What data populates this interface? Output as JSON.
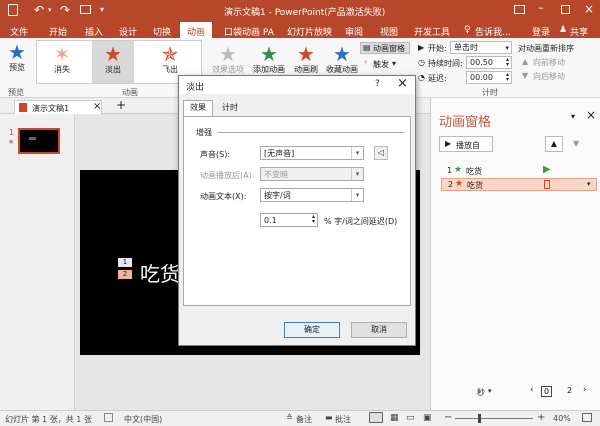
{
  "titlebar": {
    "title": "演示文稿1 - PowerPoint(产品激活失败)",
    "signin": "登录",
    "share": "共享"
  },
  "menu": {
    "items": [
      "文件",
      "开始",
      "插入",
      "设计",
      "切换",
      "动画",
      "口袋动画 PA",
      "幻灯片放映",
      "审阅",
      "视图",
      "开发工具"
    ],
    "tellme": "告诉我..."
  },
  "ribbon": {
    "preview": "预览",
    "effects": [
      {
        "label": "消失"
      },
      {
        "label": "淡出"
      },
      {
        "label": "飞出"
      }
    ],
    "effect_options": "效果选项",
    "add_animation": "添加动画",
    "painter": "动画刷",
    "anim_pane_btn": "动画窗格",
    "trigger": "触发",
    "painter2": "收藏动画",
    "start_label": "开始:",
    "start_value": "单击时",
    "duration_label": "持续时间:",
    "duration_value": "00.50",
    "delay_label": "延迟:",
    "delay_value": "00.00",
    "reorder_title": "对动画重新排序",
    "move_earlier": "向前移动",
    "move_later": "向后移动",
    "groups": {
      "preview": "预览",
      "animation": "动画",
      "timing": "计时"
    }
  },
  "doc_tab": {
    "name": "演示文稿1"
  },
  "thumb": {
    "number": "1",
    "star": "★"
  },
  "slide": {
    "text": "吃货",
    "badge1": "1",
    "badge2": "2"
  },
  "anim_pane": {
    "title": "动画窗格",
    "play_btn": "播放自",
    "items": [
      {
        "num": "1",
        "name": "吃货"
      },
      {
        "num": "2",
        "name": "吃货"
      }
    ],
    "seconds": "秒",
    "scale_from": "0",
    "scale_to": "2"
  },
  "dialog": {
    "title": "淡出",
    "help": "?",
    "tabs": [
      "效果",
      "计时"
    ],
    "section": "增强",
    "sound_label": "声音(S):",
    "sound_value": "[无声音]",
    "after_label": "动画播放后(A):",
    "after_value": "不变暗",
    "text_label": "动画文本(X):",
    "text_value": "按字/词",
    "delay_value": "0.1",
    "delay_label": "% 字/词之间延迟(D)",
    "ok": "确定",
    "cancel": "取消"
  },
  "status": {
    "slide": "幻灯片 第 1 张，共 1 张",
    "lang": "中文(中国)",
    "notes": "备注",
    "comments": "批注",
    "zoom": "40%"
  },
  "colors": {
    "accent": "#b7472a",
    "pane_title": "#c55a3a",
    "green_play": "#3a9e3a",
    "selected_row": "#fbd5c5"
  }
}
